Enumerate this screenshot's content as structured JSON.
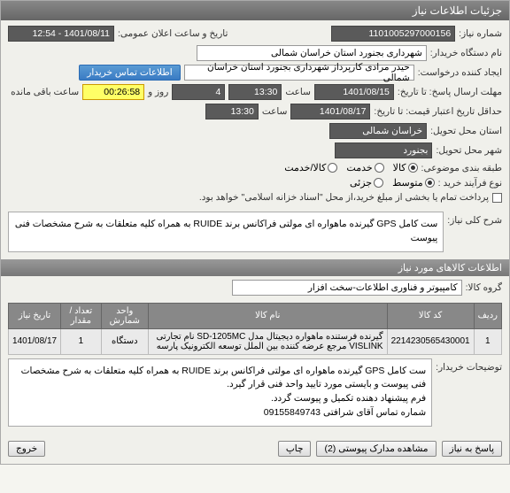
{
  "window": {
    "title": "جزئیات اطلاعات نیاز"
  },
  "fields": {
    "need_no_label": "شماره نیاز:",
    "need_no": "1101005297000156",
    "announce_label": "تاریخ و ساعت اعلان عمومی:",
    "announce": "1401/08/11 - 12:54",
    "buyer_org_label": "نام دستگاه خریدار:",
    "buyer_org": "شهرداری بجنورد استان خراسان شمالی",
    "creator_label": "ایجاد کننده درخواست:",
    "creator": "حیدر مرادی کارپرداز  شهرداری بجنورد استان خراسان شمالی",
    "contact_btn": "اطلاعات تماس خریدار",
    "deadline_label": "مهلت ارسال پاسخ: تا تاریخ:",
    "deadline_date": "1401/08/15",
    "time_label": "ساعت",
    "deadline_time": "13:30",
    "days_count": "4",
    "days_and": "روز و",
    "countdown": "00:26:58",
    "remaining": "ساعت باقی مانده",
    "validity_label": "حداقل تاریخ اعتبار قیمت: تا تاریخ:",
    "validity_date": "1401/08/17",
    "validity_time": "13:30",
    "province_label": "استان محل تحویل:",
    "province": "خراسان شمالی",
    "city_label": "شهر محل تحویل:",
    "city": "بجنورد",
    "category_label": "طبقه بندی موضوعی:",
    "cat_goods": "کالا",
    "cat_service": "خدمت",
    "cat_goods_service": "کالا/خدمت",
    "process_label": "نوع فرآیند خرید :",
    "proc_mid": "متوسط",
    "proc_small": "جزئی",
    "payment_note": "پرداخت تمام یا بخشی از مبلغ خرید،از محل \"اسناد خزانه اسلامی\" خواهد بود.",
    "summary_label": "شرح کلی نیاز:",
    "summary": "ست کامل GPS گیرنده ماهواره ای مولتی فراکانس برند RUIDE به همراه کلیه متعلقات به شرح مشخصات فنی پیوست"
  },
  "section_goods": "اطلاعات کالاهای مورد نیاز",
  "goods_group_label": "گروه کالا:",
  "goods_group": "کامپیوتر و فناوری اطلاعات-سخت افزار",
  "table": {
    "headers": {
      "row": "ردیف",
      "code": "کد کالا",
      "name": "نام کالا",
      "unit": "واحد شمارش",
      "qty": "تعداد / مقدار",
      "date": "تاریخ نیاز"
    },
    "rows": [
      {
        "row": "1",
        "code": "2214230565430001",
        "name": "گیرنده فرستنده ماهواره دیجیتال مدل SD-1205MC نام تجارتی VISLINK مرجع عرضه کننده بین الملل توسعه الکترونیک پارسه",
        "unit": "دستگاه",
        "qty": "1",
        "date": "1401/08/17"
      }
    ]
  },
  "buyer_notes_label": "توضیحات خریدار:",
  "buyer_notes": "ست کامل GPS گیرنده ماهواره ای مولتی فراکانس برند RUIDE به همراه کلیه متعلقات به شرح مشخصات فنی پیوست و بایستی مورد تایید واحد فنی قرار گیرد.\nفرم پیشنهاد دهنده تکمیل و پیوست گردد.\nشماره تماس آقای شرافتی 09155849743",
  "footer": {
    "reply": "پاسخ به نیاز",
    "attachments": "مشاهده مدارک پیوستی (2)",
    "print": "چاپ",
    "close": "خروج"
  }
}
